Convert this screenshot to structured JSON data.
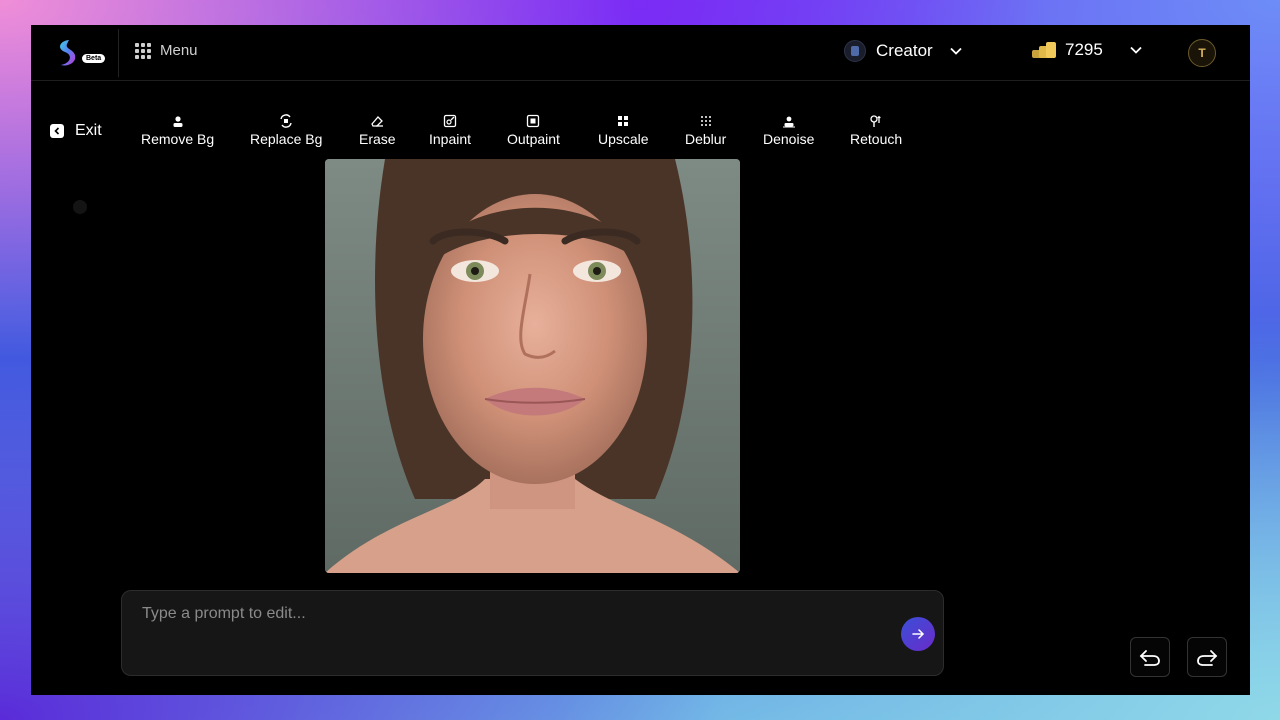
{
  "brand": {
    "badge": "Beta",
    "accent": "#6a2bc9"
  },
  "header": {
    "menu_label": "Menu",
    "plan_label": "Creator",
    "credits_value": "7295",
    "avatar_letter": "T"
  },
  "toolbar": {
    "exit_label": "Exit",
    "tools": [
      {
        "label": "Remove Bg",
        "icon": "remove-bg-icon"
      },
      {
        "label": "Replace Bg",
        "icon": "replace-bg-icon"
      },
      {
        "label": "Erase",
        "icon": "eraser-icon"
      },
      {
        "label": "Inpaint",
        "icon": "inpaint-icon"
      },
      {
        "label": "Outpaint",
        "icon": "outpaint-icon"
      },
      {
        "label": "Upscale",
        "icon": "upscale-icon"
      },
      {
        "label": "Deblur",
        "icon": "deblur-icon"
      },
      {
        "label": "Denoise",
        "icon": "denoise-icon"
      },
      {
        "label": "Retouch",
        "icon": "retouch-icon"
      }
    ]
  },
  "prompt": {
    "placeholder": "Type a prompt to edit..."
  }
}
